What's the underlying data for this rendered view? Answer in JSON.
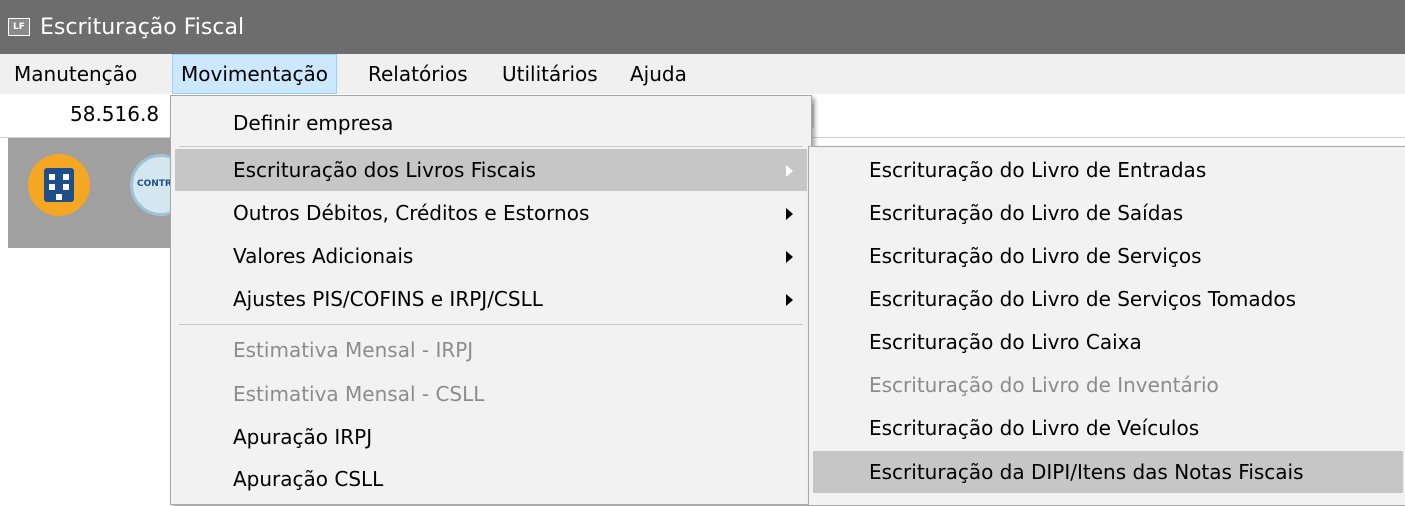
{
  "window": {
    "title": "Escrituração Fiscal",
    "icon_text": "LF",
    "icon": "app-lf-icon"
  },
  "menubar": {
    "items": [
      {
        "label": "Manutenção"
      },
      {
        "label": "Movimentação",
        "active": true
      },
      {
        "label": "Relatórios"
      },
      {
        "label": "Utilitários"
      },
      {
        "label": "Ajuda"
      }
    ]
  },
  "toolbar": {
    "cnpj_visible": "58.516.8",
    "icons": [
      "building-icon",
      "contr-icon"
    ],
    "contr_label": "CONTR"
  },
  "movimentacao_menu": {
    "items": [
      {
        "label": "Definir empresa",
        "enabled": true
      },
      {
        "label": "Escrituração dos Livros Fiscais",
        "enabled": true,
        "submenu": true,
        "highlighted": true
      },
      {
        "label": "Outros Débitos, Créditos e Estornos",
        "enabled": true,
        "submenu": true
      },
      {
        "label": "Valores Adicionais",
        "enabled": true,
        "submenu": true
      },
      {
        "label": "Ajustes PIS/COFINS e IRPJ/CSLL",
        "enabled": true,
        "submenu": true
      },
      {
        "label": "Estimativa Mensal - IRPJ",
        "enabled": false
      },
      {
        "label": "Estimativa Mensal - CSLL",
        "enabled": false
      },
      {
        "label": "Apuração IRPJ",
        "enabled": true
      },
      {
        "label": "Apuração CSLL",
        "enabled": true
      }
    ]
  },
  "escrituracao_submenu": {
    "items": [
      {
        "label": "Escrituração do Livro de Entradas",
        "enabled": true
      },
      {
        "label": "Escrituração do Livro de Saídas",
        "enabled": true
      },
      {
        "label": "Escrituração do Livro de Serviços",
        "enabled": true
      },
      {
        "label": "Escrituração do Livro de Serviços Tomados",
        "enabled": true
      },
      {
        "label": "Escrituração do Livro Caixa",
        "enabled": true
      },
      {
        "label": "Escrituração do Livro de Inventário",
        "enabled": false
      },
      {
        "label": "Escrituração do Livro de Veículos",
        "enabled": true
      },
      {
        "label": "Escrituração da DIPI/Itens das Notas Fiscais",
        "enabled": true,
        "highlighted": true
      }
    ]
  },
  "colors": {
    "titlebar": "#6d6d6d",
    "menu_bg": "#f2f2f2",
    "highlight": "#c6c6c6",
    "disabled_text": "#8c8c8c",
    "active_menubar": "#cce8ff"
  }
}
